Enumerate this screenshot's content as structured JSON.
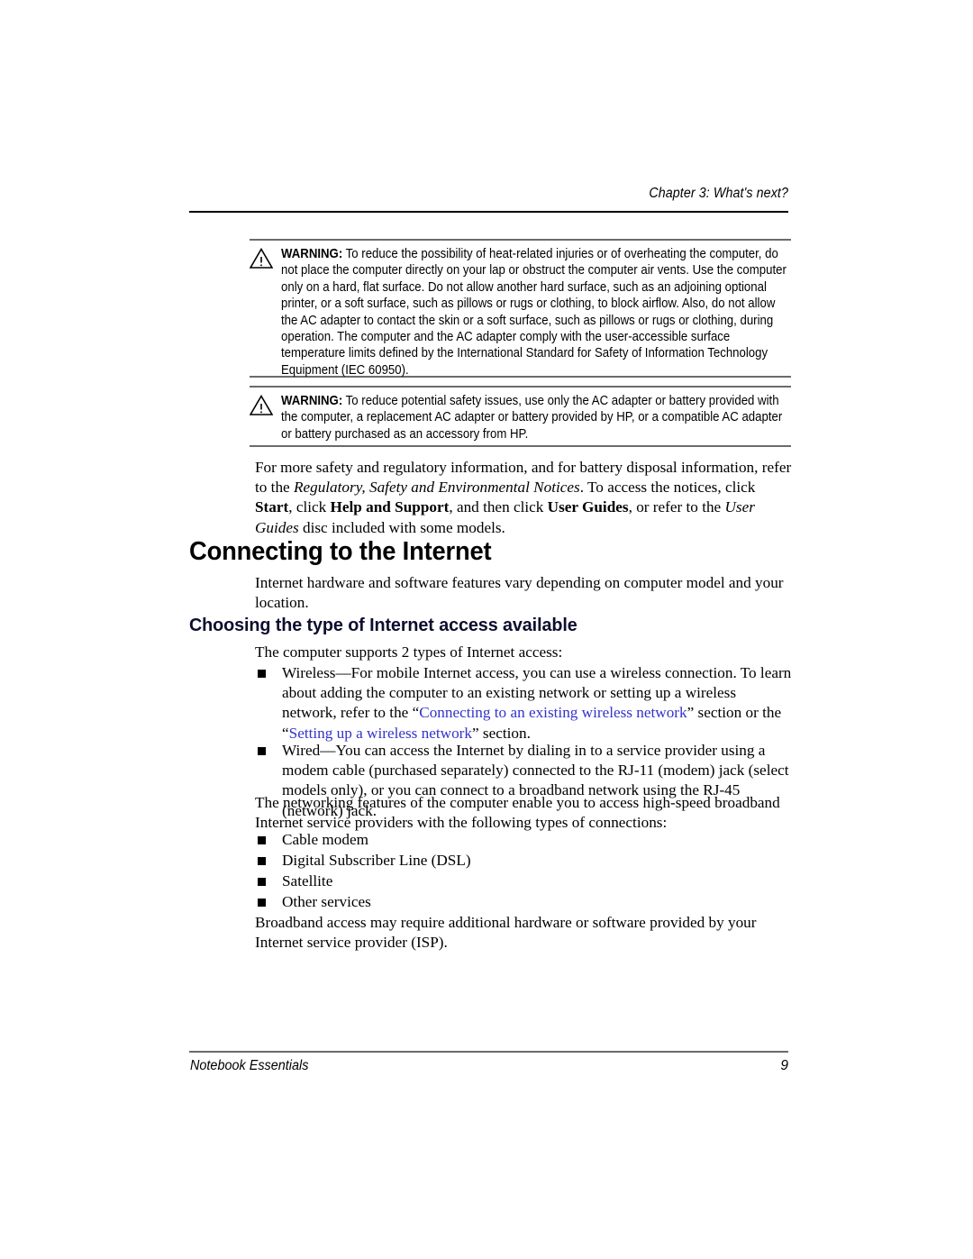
{
  "header": {
    "chapter_text": "Chapter 3: What's next?"
  },
  "warnings": [
    {
      "icon": "warning-triangle-icon",
      "label": "WARNING:",
      "text": " To reduce the possibility of heat-related injuries or of overheating the computer, do not place the computer directly on your lap or obstruct the computer air vents. Use the computer only on a hard, flat surface. Do not allow another hard surface, such as an adjoining optional printer, or a soft surface, such as pillows or rugs or clothing, to block airflow. Also, do not allow the AC adapter to contact the skin or a soft surface, such as pillows or rugs or clothing, during operation. The computer and the AC adapter comply with the user-accessible surface temperature limits defined by the International Standard for Safety of Information Technology Equipment (IEC 60950)."
    },
    {
      "icon": "warning-triangle-icon",
      "label": "WARNING:",
      "text": " To reduce potential safety issues, use only the AC adapter or battery provided with the computer, a replacement AC adapter or battery provided by HP, or a compatible AC adapter or battery purchased as an accessory from HP."
    }
  ],
  "regulatory_paragraph": {
    "part1": "For more safety and regulatory information, and for battery disposal information, refer to the ",
    "italic1": "Regulatory, Safety and Environmental Notices",
    "part2": ". To access the notices, click ",
    "bold1": "Start",
    "part3": ", click ",
    "bold2": "Help and Support",
    "part4": ", and then click ",
    "bold3": "User Guides",
    "part5": ", or refer to the ",
    "italic2": "User Guides",
    "part6": " disc included with some models."
  },
  "section": {
    "heading": "Connecting to the Internet",
    "intro": "Internet hardware and software features vary depending on computer model and your location.",
    "subheading": "Choosing the type of Internet access available",
    "intro2": "The computer supports 2 types of Internet access:"
  },
  "access_bullets": [
    {
      "part1": "Wireless—For mobile Internet access, you can use a wireless connection. To learn about adding the computer to an existing network or setting up a wireless network, refer to the “",
      "link1": "Connecting to an existing wireless network",
      "part2": "” section or the “",
      "link2": "Setting up a wireless network",
      "part3": "” section."
    },
    {
      "part1": "Wired—You can access the Internet by dialing in to a service provider using a modem cable (purchased separately) connected to the RJ-11 (modem) jack (select models only), or you can connect to a broadband network using the RJ-45 (network) jack.",
      "link1": "",
      "part2": "",
      "link2": "",
      "part3": ""
    }
  ],
  "networking_paragraph": "The networking features of the computer enable you to access high-speed broadband Internet service providers with the following types of connections:",
  "connection_types": [
    "Cable modem",
    "Digital Subscriber Line (DSL)",
    "Satellite",
    "Other services"
  ],
  "broadband_paragraph": "Broadband access may require additional hardware or software provided by your Internet service provider (ISP).",
  "footer": {
    "left": "Notebook Essentials",
    "page_number": "9"
  },
  "colors": {
    "link": "#3333cc",
    "rule": "#6b6b6b",
    "header_rule": "#000000",
    "text": "#000000"
  }
}
